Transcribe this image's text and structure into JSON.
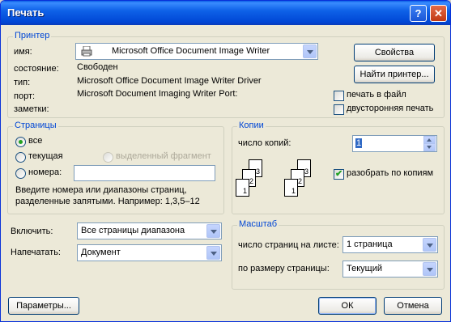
{
  "window": {
    "title": "Печать"
  },
  "printer": {
    "legend": "Принтер",
    "name_label": "имя:",
    "name_value": "Microsoft Office Document Image Writer",
    "status_label": "состояние:",
    "status_value": "Свободен",
    "type_label": "тип:",
    "type_value": "Microsoft Office Document Image Writer Driver",
    "port_label": "порт:",
    "port_value": "Microsoft Document Imaging Writer Port:",
    "notes_label": "заметки:",
    "properties_button": "Свойства",
    "find_button": "Найти принтер...",
    "print_to_file": "печать в файл",
    "print_to_file_checked": false,
    "duplex": "двусторонняя печать",
    "duplex_checked": false
  },
  "pages": {
    "legend": "Страницы",
    "all": "все",
    "current": "текущая",
    "selection": "выделенный фрагмент",
    "numbers": "номера:",
    "numbers_value": "",
    "selected": "all",
    "hint": "Введите номера или диапазоны страниц, разделенные запятыми. Например: 1,3,5–12"
  },
  "copies": {
    "legend": "Копии",
    "count_label": "число копий:",
    "count_value": "1",
    "collate_label": "разобрать по копиям",
    "collate_checked": true,
    "stack_digits": [
      "3",
      "2",
      "1"
    ]
  },
  "include": {
    "label": "Включить:",
    "value": "Все страницы диапазона"
  },
  "print_what": {
    "label": "Напечатать:",
    "value": "Документ"
  },
  "zoom": {
    "legend": "Масштаб",
    "pages_per_sheet_label": "число страниц на листе:",
    "pages_per_sheet_value": "1 страница",
    "scale_label": "по размеру страницы:",
    "scale_value": "Текущий"
  },
  "footer": {
    "options": "Параметры...",
    "ok": "ОК",
    "cancel": "Отмена"
  },
  "icons": [
    "printer-icon",
    "help-icon",
    "close-icon",
    "chevron-down-icon"
  ]
}
